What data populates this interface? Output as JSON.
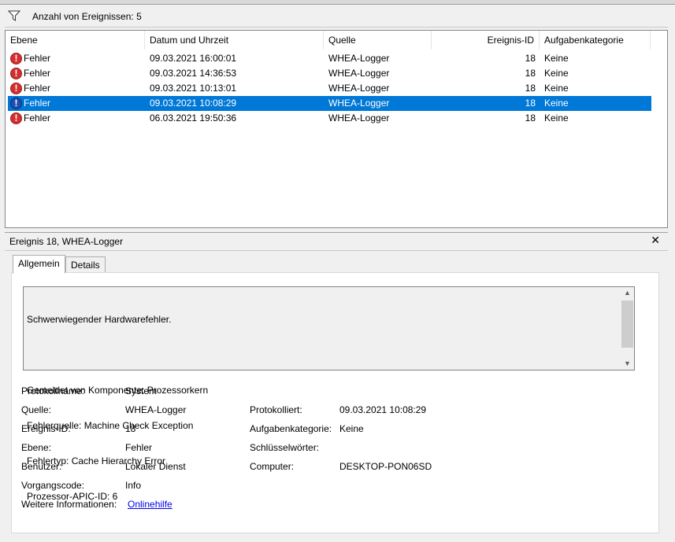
{
  "filter": {
    "text": "Anzahl von Ereignissen: 5"
  },
  "columns": [
    "Ebene",
    "Datum und Uhrzeit",
    "Quelle",
    "Ereignis-ID",
    "Aufgabenkategorie"
  ],
  "events": [
    {
      "level": "Fehler",
      "datetime": "09.03.2021 16:00:01",
      "source": "WHEA-Logger",
      "id": "18",
      "category": "Keine"
    },
    {
      "level": "Fehler",
      "datetime": "09.03.2021 14:36:53",
      "source": "WHEA-Logger",
      "id": "18",
      "category": "Keine"
    },
    {
      "level": "Fehler",
      "datetime": "09.03.2021 10:13:01",
      "source": "WHEA-Logger",
      "id": "18",
      "category": "Keine"
    },
    {
      "level": "Fehler",
      "datetime": "09.03.2021 10:08:29",
      "source": "WHEA-Logger",
      "id": "18",
      "category": "Keine"
    },
    {
      "level": "Fehler",
      "datetime": "06.03.2021 19:50:36",
      "source": "WHEA-Logger",
      "id": "18",
      "category": "Keine"
    }
  ],
  "detail": {
    "title": "Ereignis 18, WHEA-Logger",
    "close": "✕",
    "tabs": [
      "Allgemein",
      "Details"
    ],
    "description": [
      "Schwerwiegender Hardwarefehler.",
      "",
      "Gemeldet von Komponente: Prozessorkern",
      "Fehlerquelle: Machine Check Exception",
      "Fehlertyp: Cache Hierarchy Error",
      "Prozessor-APIC-ID: 6"
    ],
    "props": {
      "protokollname_label": "Protokollname:",
      "protokollname": "System",
      "quelle_label": "Quelle:",
      "quelle": "WHEA-Logger",
      "protokolliert_label": "Protokolliert:",
      "protokolliert": "09.03.2021 10:08:29",
      "ereignis_id_label": "Ereignis-ID:",
      "ereignis_id": "18",
      "aufgabenkategorie_label": "Aufgabenkategorie:",
      "aufgabenkategorie": "Keine",
      "ebene_label": "Ebene:",
      "ebene": "Fehler",
      "schluesselwoerter_label": "Schlüsselwörter:",
      "benutzer_label": "Benutzer:",
      "benutzer": "Lokaler Dienst",
      "computer_label": "Computer:",
      "computer": "DESKTOP-PON06SD",
      "vorgangscode_label": "Vorgangscode:",
      "vorgangscode": "Info",
      "weitere_label": "Weitere Informationen:",
      "weitere_link": "Onlinehilfe"
    }
  },
  "colors": {
    "selection": "#0078d7",
    "error_icon": "#d32f2f",
    "link": "#0000ee"
  },
  "icons": {
    "filter": "filter-funnel-icon",
    "row": "error-icon"
  }
}
